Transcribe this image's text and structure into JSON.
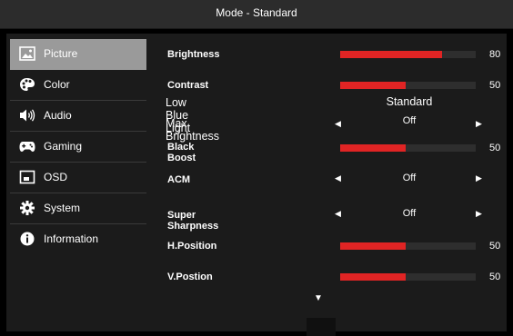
{
  "header": {
    "title": "Mode - Standard"
  },
  "sidebar": {
    "items": [
      {
        "label": "Picture",
        "icon": "picture-icon",
        "active": true
      },
      {
        "label": "Color",
        "icon": "palette-icon"
      },
      {
        "label": "Audio",
        "icon": "speaker-icon"
      },
      {
        "label": "Gaming",
        "icon": "gamepad-icon"
      },
      {
        "label": "OSD",
        "icon": "osd-icon"
      },
      {
        "label": "System",
        "icon": "gear-icon"
      },
      {
        "label": "Information",
        "icon": "info-icon"
      }
    ]
  },
  "settings": {
    "brightness": {
      "label": "Brightness",
      "value": "80",
      "level": 0.755
    },
    "contrast": {
      "label": "Contrast",
      "value": "50",
      "level": 0.48
    },
    "low_blue_light": {
      "label": "Low Blue Light",
      "option": "Standard"
    },
    "max_brightness": {
      "label": "Max Brightness",
      "option": "Off"
    },
    "black_boost": {
      "label": "Black Boost",
      "value": "50",
      "level": 0.48
    },
    "acm": {
      "label": "ACM",
      "option": "Off"
    },
    "super_sharpness": {
      "label": "Super Sharpness",
      "option": "Off"
    },
    "h_position": {
      "label": "H.Position",
      "value": "50",
      "level": 0.48
    },
    "v_position": {
      "label": "V.Postion",
      "value": "50",
      "level": 0.48
    }
  },
  "colors": {
    "accent": "#e02424",
    "track": "#2e2e2e",
    "active_item": "#9a9a9a"
  }
}
